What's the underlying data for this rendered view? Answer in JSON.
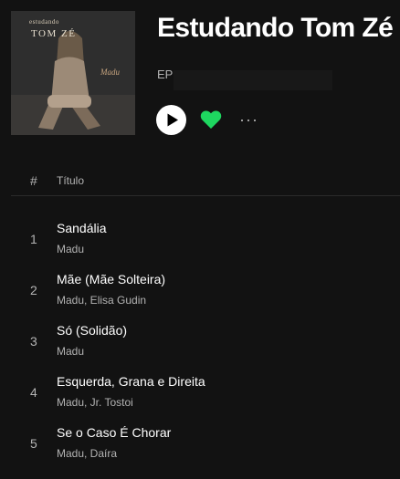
{
  "album": {
    "title": "Estudando Tom Zé",
    "type": "EP",
    "cover": {
      "top_text": "estudando",
      "main_text": "TOM ZÉ",
      "signature": "Madu"
    }
  },
  "controls": {
    "play_icon": "play-icon",
    "like_icon": "heart-filled-icon",
    "more_icon": "more-options-icon",
    "more_label": "···",
    "accent_color": "#1ed760"
  },
  "table": {
    "header": {
      "number": "#",
      "title": "Título"
    },
    "tracks": [
      {
        "number": "1",
        "name": "Sandália",
        "artists": "Madu"
      },
      {
        "number": "2",
        "name": "Mãe (Mãe Solteira)",
        "artists": "Madu, Elisa Gudin"
      },
      {
        "number": "3",
        "name": "Só (Solidão)",
        "artists": "Madu"
      },
      {
        "number": "4",
        "name": "Esquerda, Grana e Direita",
        "artists": "Madu, Jr. Tostoi"
      },
      {
        "number": "5",
        "name": "Se o Caso É Chorar",
        "artists": "Madu, Daíra"
      }
    ]
  }
}
